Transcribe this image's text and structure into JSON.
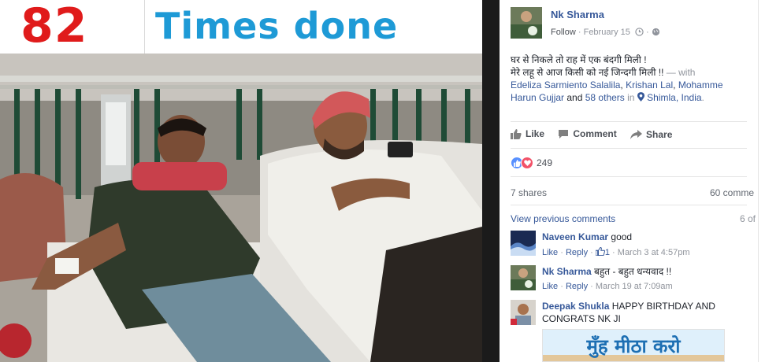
{
  "banner": {
    "number": "82",
    "text": "Times done"
  },
  "post": {
    "author": "Nk Sharma",
    "follow_label": "Follow",
    "date": "February 15",
    "body_line1": "घर से निकले तो राह में एक बंदगी मिली !",
    "body_line2": "मेरे लहू से आज किसी को नई जिन्दगी मिली !!",
    "with_text": "— with",
    "tagged1": "Edeliza Sarmiento Salalila",
    "tagged2": "Krishan Lal",
    "tagged3": "Mohamme",
    "tagged4": "Harun Gujjar",
    "and_text": "and",
    "others": "58 others",
    "in_text": "in",
    "location": "Shimla, India",
    "comma": ","
  },
  "actions": {
    "like": "Like",
    "comment": "Comment",
    "share": "Share"
  },
  "stats": {
    "reactions_count": "249",
    "shares": "7 shares",
    "comments": "60 comme",
    "view_previous": "View previous comments",
    "page_count": "6 of"
  },
  "comments": [
    {
      "author": "Naveen Kumar",
      "text": "good",
      "like": "Like",
      "reply": "Reply",
      "likes": "1",
      "time": "March 3 at 4:57pm"
    },
    {
      "author": "Nk Sharma",
      "text": "बहुत - बहुत धन्यवाद !!",
      "like": "Like",
      "reply": "Reply",
      "time": "March 19 at 7:09am"
    },
    {
      "author": "Deepak Shukla",
      "text_line1": "HAPPY BIRTHDAY AND",
      "text_line2": "CONGRATS NK JI"
    }
  ],
  "sticker": {
    "text": "मुँह मीठा करो"
  },
  "colors": {
    "banner_number": "#e01b1b",
    "banner_text": "#1e9ad6",
    "link": "#365899",
    "meta": "#90949c"
  },
  "icons": [
    "clock-icon",
    "globe-icon",
    "location-pin-icon",
    "like-icon",
    "comment-icon",
    "share-icon",
    "like-reaction-icon",
    "love-reaction-icon",
    "thumbs-up-icon"
  ]
}
